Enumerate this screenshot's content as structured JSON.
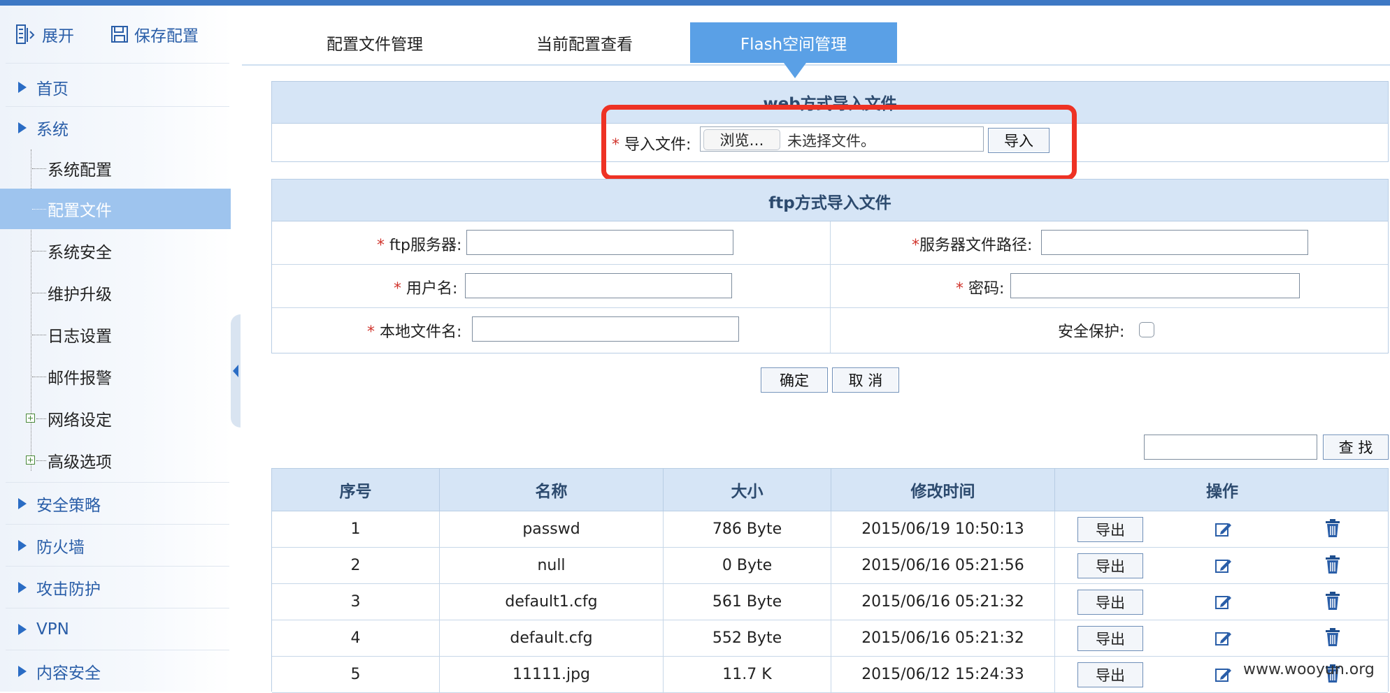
{
  "toolbar": {
    "expand_label": "展开",
    "save_label": "保存配置"
  },
  "sidebar": {
    "items": [
      {
        "label": "首页"
      },
      {
        "label": "系统"
      },
      {
        "label": "系统配置"
      },
      {
        "label": "配置文件"
      },
      {
        "label": "系统安全"
      },
      {
        "label": "维护升级"
      },
      {
        "label": "日志设置"
      },
      {
        "label": "邮件报警"
      },
      {
        "label": "网络设定"
      },
      {
        "label": "高级选项"
      },
      {
        "label": "安全策略"
      },
      {
        "label": "防火墙"
      },
      {
        "label": "攻击防护"
      },
      {
        "label": "VPN"
      },
      {
        "label": "内容安全"
      }
    ]
  },
  "tabs": [
    {
      "label": "配置文件管理"
    },
    {
      "label": "当前配置查看"
    },
    {
      "label": "Flash空间管理"
    }
  ],
  "web_import": {
    "title": "web方式导入文件",
    "required_mark": "*",
    "file_label": " 导入文件:",
    "browse_label": "浏览…",
    "no_file_text": "未选择文件。",
    "import_button": "导入"
  },
  "ftp_import": {
    "title": "ftp方式导入文件",
    "server_label": " ftp服务器:",
    "path_label": "服务器文件路径:",
    "user_label": " 用户名:",
    "password_label": " 密码:",
    "local_label": " 本地文件名:",
    "security_label": "安全保护:",
    "confirm_button": "确定",
    "cancel_button": "取 消"
  },
  "search": {
    "button_label": "查 找"
  },
  "table": {
    "headers": [
      "序号",
      "名称",
      "大小",
      "修改时间",
      "操作"
    ],
    "export_label": "导出",
    "rows": [
      {
        "no": "1",
        "name": "passwd",
        "size": "786 Byte",
        "time": "2015/06/19 10:50:13"
      },
      {
        "no": "2",
        "name": "null",
        "size": "0 Byte",
        "time": "2015/06/16 05:21:56"
      },
      {
        "no": "3",
        "name": "default1.cfg",
        "size": "561 Byte",
        "time": "2015/06/16 05:21:32"
      },
      {
        "no": "4",
        "name": "default.cfg",
        "size": "552 Byte",
        "time": "2015/06/16 05:21:32"
      },
      {
        "no": "5",
        "name": "11111.jpg",
        "size": "11.7 K",
        "time": "2015/06/12 15:24:33"
      }
    ]
  },
  "watermark": "www.wooyun.org",
  "colors": {
    "accent": "#5aa0e6",
    "highlight": "#ee3224",
    "header_bg": "#d6e5f6"
  }
}
